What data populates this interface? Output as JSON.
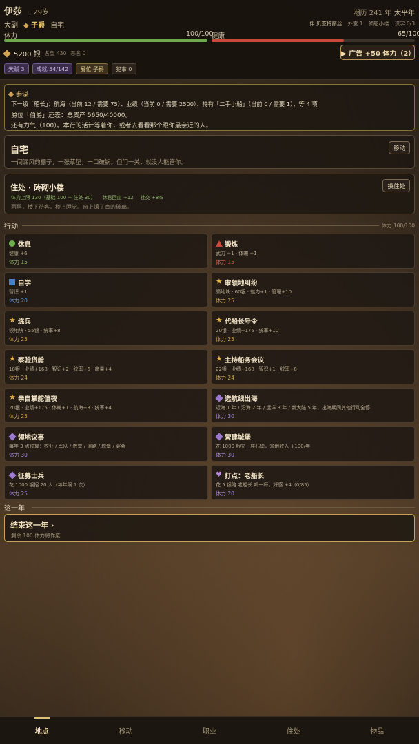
{
  "header": {
    "name": "伊莎",
    "age": "· 29岁",
    "calendar": "潮历 241 年",
    "era": "太平年",
    "role": "大副",
    "rank": "子爵",
    "home": "自宅",
    "right_meta": [
      "伴 贝亚特丽丝",
      "外室 1",
      "领船小楼",
      "识字 0/3"
    ],
    "stamina_label": "体力",
    "stamina_value": "100/100",
    "stamina_fraction": 1.0,
    "health_label": "健康",
    "health_value": "65/100",
    "health_fraction": 0.65,
    "silver": "5200 银",
    "reputation": "名望 430",
    "infamy": "恶名 0",
    "ad_button": "▶ 广告 +50 体力（2）",
    "tags": [
      "天赋 3",
      "成就 54/142",
      "爵位 子爵",
      "犯事 0"
    ]
  },
  "hint": {
    "title": "参谋",
    "lines": [
      "下一级「船长」：航海（当前 12 / 需要 75）、业绩（当前 0 / 需要 2500）、持有「二手小船」（当前 0 / 需要 1）、等 4 项",
      "爵位「伯爵」还差：总资产 5650/40000。",
      "还有力气（100）。本行的活计等着你，或者去看看那个跟你最亲近的人。"
    ]
  },
  "location": {
    "title": "自宅",
    "desc": "一间漏风的棚子，一张草垫，一口破锅。但门一关，就没人能管你。",
    "button": "移动"
  },
  "residence": {
    "title": "住处 · 砖砌小楼",
    "stat1": "体力上限 130（基础 100 + 住处 30）",
    "stat2": "休息回血 +12",
    "stat3": "社交 +8%",
    "desc": "两层，楼下待客，楼上睡觉。窗上镶了真的玻璃。",
    "button": "换住处"
  },
  "actions_section": {
    "title": "行动",
    "stamina": "体力 100/100"
  },
  "actions": [
    {
      "name": "休息",
      "effect": "健康 +6",
      "cost": "体力 15",
      "icon": "green-circle-icon"
    },
    {
      "name": "锻炼",
      "effect": "武力 +1 · 体魄 +1",
      "cost": "体力 15",
      "icon": "red-triangle-icon"
    },
    {
      "name": "自学",
      "effect": "智识 +1",
      "cost": "体力 20",
      "icon": "blue-square-icon"
    },
    {
      "name": "审领地纠纷",
      "effect": "领地块 · 60银 · 魅力+1 · 管理+10",
      "cost": "体力 25",
      "icon": "star-icon"
    },
    {
      "name": "练兵",
      "effect": "领地块 · 55银 · 统率+8",
      "cost": "体力 25",
      "icon": "star-icon"
    },
    {
      "name": "代船长号令",
      "effect": "20银 · 业绩+175 · 统率+10",
      "cost": "体力 25",
      "icon": "star-icon"
    },
    {
      "name": "察验货舱",
      "effect": "18银 · 业绩+168 · 智识+2 · 统率+6 · 商量+4",
      "cost": "体力 24",
      "icon": "star-icon"
    },
    {
      "name": "主持船务会议",
      "effect": "22银 · 业绩+168 · 智识+1 · 统率+8",
      "cost": "体力 24",
      "icon": "star-icon"
    },
    {
      "name": "亲自掌舵值夜",
      "effect": "20银 · 业绩+175 · 体魄+1 · 航海+3 · 统率+4",
      "cost": "体力 25",
      "icon": "star-icon"
    },
    {
      "name": "选航线出海",
      "effect": "近海 1 年 / 沿海 2 年 / 远洋 3 年 / 新大陆 5 年，出海期间其他行动全停",
      "cost": "体力 30",
      "icon": "purple-diamond-icon"
    },
    {
      "name": "领地议事",
      "effect": "每年 3 点预算：农业 / 军队 / 教堂 / 道路 / 城堡 / 宴会",
      "cost": "体力 30",
      "icon": "purple-diamond-icon"
    },
    {
      "name": "营建城堡",
      "effect": "花 1000 银立一座石堡，领地收入 +100/年",
      "cost": "体力 30",
      "icon": "purple-diamond-icon"
    },
    {
      "name": "征募士兵",
      "effect": "花 1000 银招 20 人（每年限 1 次）",
      "cost": "体力 25",
      "icon": "purple-diamond-icon"
    },
    {
      "name": "打点：老船长",
      "effect": "花 5 银陪 老船长 喝一杯，好感 +4（0/85）",
      "cost": "体力 20",
      "icon": "heart-icon"
    }
  ],
  "year_section": {
    "title": "这一年"
  },
  "end_year": {
    "title": "结束这一年 ›",
    "desc": "剩余 100 体力将作废"
  },
  "nav": [
    "地点",
    "移动",
    "职业",
    "住处",
    "物品"
  ]
}
